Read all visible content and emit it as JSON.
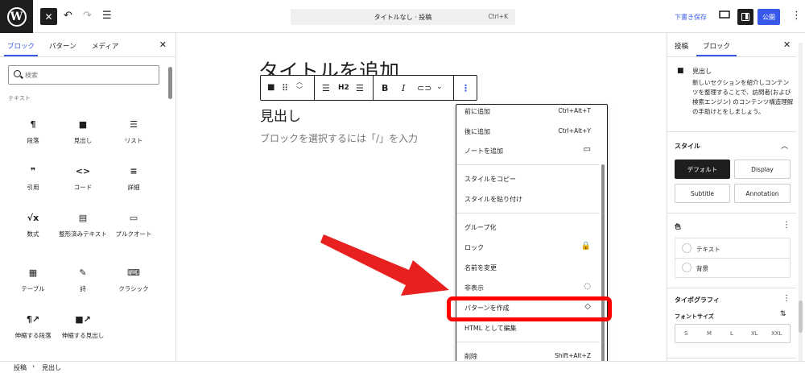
{
  "topbar": {
    "command_title": "タイトルなし · 投稿",
    "command_shortcut": "Ctrl+K",
    "save_draft": "下書き保存",
    "publish": "公開",
    "more": "⋮"
  },
  "inserter": {
    "tabs": [
      "ブロック",
      "パターン",
      "メディア"
    ],
    "search_placeholder": "検索",
    "category": "テキスト",
    "blocks": [
      {
        "icon": "¶",
        "label": "段落"
      },
      {
        "icon": "■",
        "label": "見出し"
      },
      {
        "icon": "☰",
        "label": "リスト"
      },
      {
        "icon": "❞",
        "label": "引用"
      },
      {
        "icon": "<>",
        "label": "コード"
      },
      {
        "icon": "≡",
        "label": "詳細"
      },
      {
        "icon": "√x",
        "label": "数式"
      },
      {
        "icon": "▤",
        "label": "整形済みテキスト"
      },
      {
        "icon": "▭",
        "label": "プルクオート"
      },
      {
        "icon": "▦",
        "label": "テーブル"
      },
      {
        "icon": "✎",
        "label": "詩"
      },
      {
        "icon": "⌨",
        "label": "クラシック"
      },
      {
        "icon": "¶↗",
        "label": "伸縮する段落"
      },
      {
        "icon": "■↗",
        "label": "伸縮する見出し"
      }
    ]
  },
  "editor": {
    "title_placeholder": "タイトルを追加",
    "heading": "見出し",
    "block_placeholder": "ブロックを選択するには「/」を入力",
    "toolbar_h2": "H2",
    "toolbar_bold": "B",
    "toolbar_italic": "I"
  },
  "options_menu": {
    "items": [
      {
        "label": "前に追加",
        "shortcut": "Ctrl+Alt+T"
      },
      {
        "label": "後に追加",
        "shortcut": "Ctrl+Alt+Y"
      },
      {
        "label": "ノートを追加",
        "shortcut": ""
      },
      {
        "label": "スタイルをコピー",
        "shortcut": ""
      },
      {
        "label": "スタイルを貼り付け",
        "shortcut": ""
      },
      {
        "label": "グループ化",
        "shortcut": ""
      },
      {
        "label": "ロック",
        "shortcut": ""
      },
      {
        "label": "名前を変更",
        "shortcut": ""
      },
      {
        "label": "非表示",
        "shortcut": ""
      },
      {
        "label": "パターンを作成",
        "shortcut": ""
      },
      {
        "label": "HTML として編集",
        "shortcut": ""
      },
      {
        "label": "削除",
        "shortcut": "Shift+Alt+Z"
      }
    ],
    "highlight_color": "#ff0000"
  },
  "sidebar": {
    "tabs": [
      "投稿",
      "ブロック"
    ],
    "block_name": "見出し",
    "block_description": "新しいセクションを紹介しコンテンツを整理することで、訪問者(および検索エンジン) のコンテンツ構造理解の手助けとをしましょう。",
    "styles_title": "スタイル",
    "styles": [
      "デフォルト",
      "Display",
      "Subtitle",
      "Annotation"
    ],
    "color_title": "色",
    "color_items": [
      "テキスト",
      "背景"
    ],
    "typography_title": "タイポグラフィ",
    "font_size_label": "フォントサイズ",
    "font_sizes": [
      "S",
      "M",
      "L",
      "XL",
      "XXL"
    ]
  },
  "breadcrumb": [
    "投稿",
    "見出し"
  ],
  "colors": {
    "accent": "#3858e9",
    "dark": "#1e1e1e",
    "arrow": "#e8201f"
  }
}
